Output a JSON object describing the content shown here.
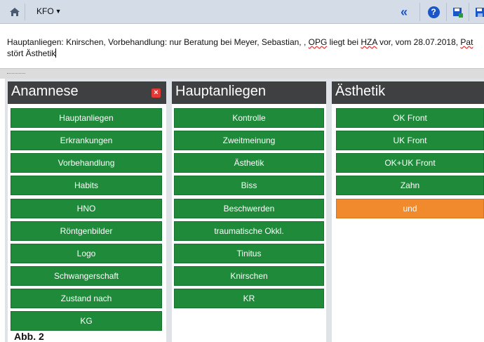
{
  "toolbar": {
    "menu_label": "KFO",
    "icons": [
      "home-icon",
      "collapse-left-icon",
      "help-icon",
      "save-add-icon",
      "save-icon"
    ],
    "accent": "#1a56c8"
  },
  "editor": {
    "line1_a": "Hauptanliegen: Knirschen, Vorbehandlung: nur Beratung bei Meyer, Sebastian, , ",
    "line1_opg": "OPG",
    "line1_b": " liegt bei ",
    "line1_hza": "HZA",
    "line1_c": " vor, vom 28.07.2018, ",
    "line1_pat": "Pat",
    "line2": "stört Ästhetik"
  },
  "panels": [
    {
      "title": "Anamnese",
      "items": [
        "Hauptanliegen",
        "Erkrankungen",
        "Vorbehandlung",
        "Habits",
        "HNO",
        "Röntgenbilder",
        "Logo",
        "Schwangerschaft",
        "Zustand nach",
        "KG"
      ]
    },
    {
      "title": "Hauptanliegen",
      "items": [
        "Kontrolle",
        "Zweitmeinung",
        "Ästhetik",
        "Biss",
        "Beschwerden",
        "traumatische Okkl.",
        "Tinitus",
        "Knirschen",
        "KR"
      ]
    },
    {
      "title": "Ästhetik",
      "items": [
        "OK Front",
        "UK Front",
        "OK+UK Front",
        "Zahn",
        "und"
      ]
    }
  ],
  "colors": {
    "item_green": "#1e8a3a",
    "item_orange": "#f08a2c",
    "header_dark": "#3e4042"
  },
  "caption": "Abb. 2"
}
